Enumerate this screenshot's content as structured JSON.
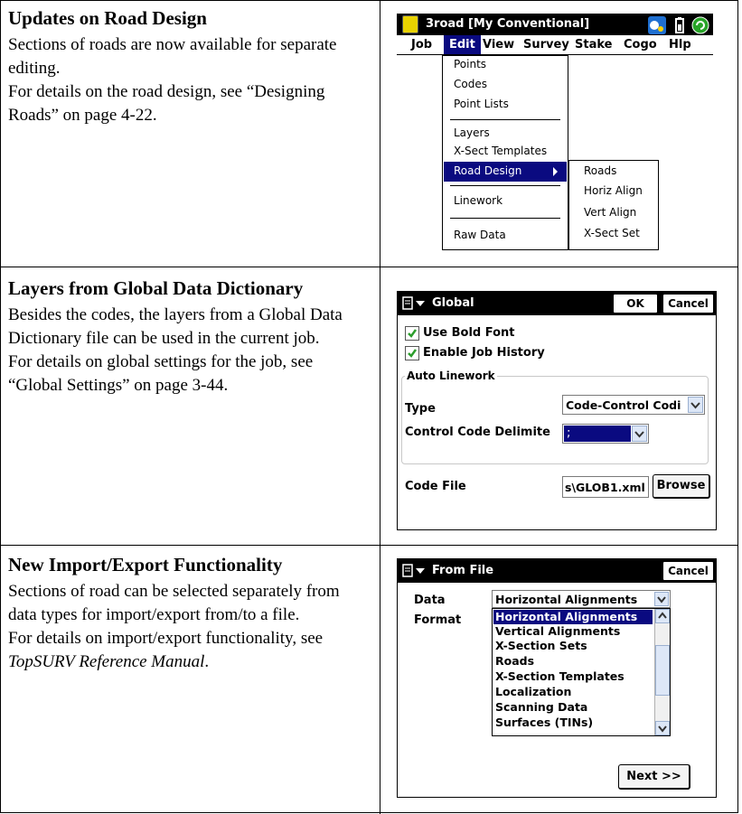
{
  "sections": [
    {
      "title": "Updates on Road Design",
      "body_1": "Sections of roads are now available for separate editing.",
      "body_2": "For details on the road design, see “Designing Roads” on page 4-22."
    },
    {
      "title": "Layers from Global Data Dictionary",
      "body_1": "Besides the codes, the layers from a Global Data Dictionary file can be used in the current job.",
      "body_2": "For details on global settings for the job, see “Global Settings” on page 3-44."
    },
    {
      "title": "New Import/Export Functionality",
      "body_1": "Sections of road can be selected separately from data types for import/export from/to a file.",
      "body_2a": "For details on import/export functionality, see ",
      "body_2b": "TopSURV Reference Manual",
      "body_2c": "."
    }
  ],
  "screen1": {
    "title": "3road [My Conventional]",
    "menubar": [
      "Job",
      "Edit",
      "View",
      "Survey",
      "Stake",
      "Cogo",
      "Hlp"
    ],
    "edit_menu": [
      "Points",
      "Codes",
      "Point Lists",
      "Layers",
      "X-Sect Templates",
      "Road Design",
      "Linework",
      "Raw Data"
    ],
    "submenu": [
      "Roads",
      "Horiz Align",
      "Vert Align",
      "X-Sect Set"
    ]
  },
  "screen2": {
    "title": "Global",
    "ok": "OK",
    "cancel": "Cancel",
    "use_bold_font": "Use Bold Font",
    "enable_job_history": "Enable Job History",
    "group_label": "Auto Linework",
    "type_label": "Type",
    "type_value": "Code-Control Codi",
    "delim_label": "Control Code Delimite",
    "delim_value": ";",
    "code_file_label": "Code File",
    "code_file_value": "s\\GLOB1.xml",
    "browse": "Browse"
  },
  "screen3": {
    "title": "From File",
    "cancel": "Cancel",
    "data_label": "Data",
    "data_value": "Horizontal Alignments",
    "format_label": "Format",
    "options": [
      "Horizontal Alignments",
      "Vertical Alignments",
      "X-Section Sets",
      "Roads",
      "X-Section Templates",
      "Localization",
      "Scanning Data",
      "Surfaces (TINs)"
    ],
    "next": "Next >>"
  },
  "colors": {
    "selection": "#0a0a80",
    "checkbox_green": "#2c9d2c",
    "titlebar": "#000000",
    "frame_bg": "#d4d0c8"
  }
}
